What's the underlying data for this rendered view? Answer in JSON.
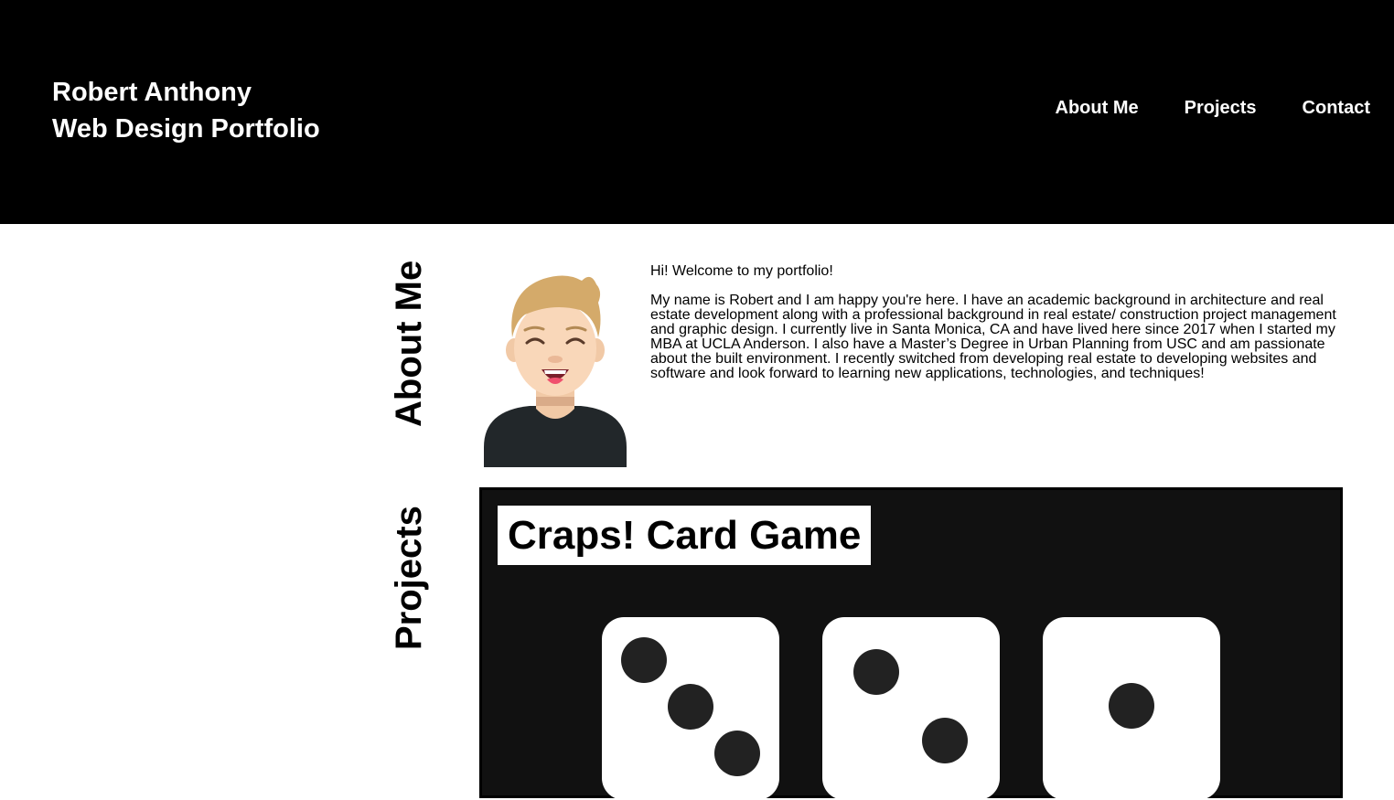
{
  "header": {
    "name": "Robert Anthony",
    "subtitle": "Web Design Portfolio",
    "nav": [
      {
        "label": "About Me"
      },
      {
        "label": "Projects"
      },
      {
        "label": "Contact"
      }
    ]
  },
  "about": {
    "heading": "About Me",
    "greeting": "Hi! Welcome to my portfolio!",
    "bio": "My name is Robert and I am happy you're here. I have an academic background in architecture and real estate development along with a professional background in real estate/ construction project management and graphic design. I currently live in Santa Monica, CA and have lived here since 2017 when I started my MBA at UCLA Anderson. I also have a Master’s Degree in Urban Planning from USC and am passionate about the built environment. I recently switched from developing real estate to developing websites and software and look forward to learning new applications, technologies, and techniques!"
  },
  "projects": {
    "heading": "Projects",
    "items": [
      {
        "title": "Craps! Card Game",
        "dice": [
          3,
          2,
          1
        ]
      }
    ]
  }
}
